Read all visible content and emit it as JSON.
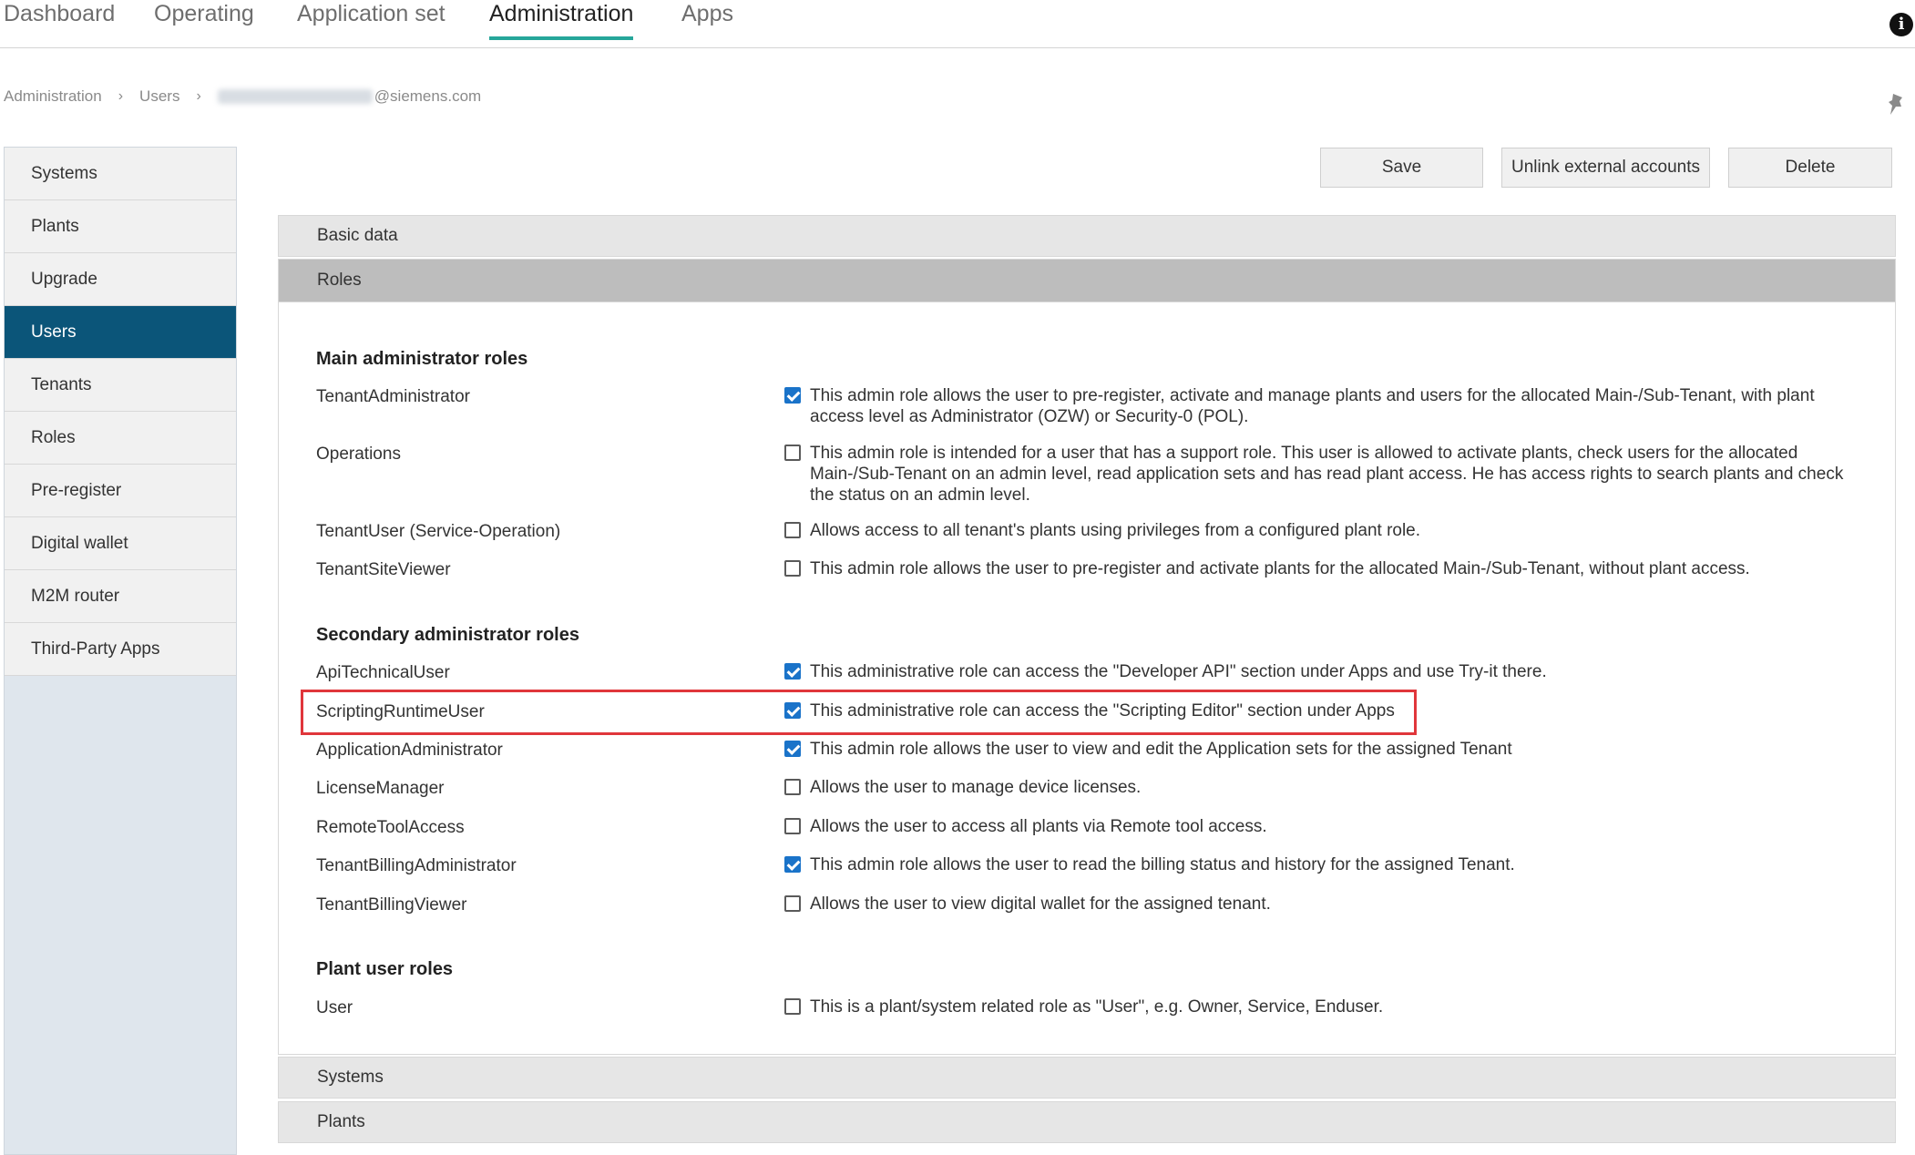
{
  "topnav": {
    "tabs": [
      "Dashboard",
      "Operating",
      "Application set",
      "Administration",
      "Apps"
    ],
    "active_tab": "Administration"
  },
  "breadcrumb": {
    "items": [
      "Administration",
      "Users"
    ],
    "user_suffix": "@siemens.com"
  },
  "sidebar": {
    "items": [
      "Systems",
      "Plants",
      "Upgrade",
      "Users",
      "Tenants",
      "Roles",
      "Pre-register",
      "Digital wallet",
      "M2M router",
      "Third-Party Apps"
    ],
    "active_item": "Users"
  },
  "actions": {
    "save": "Save",
    "unlink": "Unlink external accounts",
    "delete": "Delete"
  },
  "accordion": {
    "basic_data": "Basic data",
    "roles": "Roles",
    "systems": "Systems",
    "plants": "Plants"
  },
  "roles": {
    "main_title": "Main administrator roles",
    "main": [
      {
        "name": "TenantAdministrator",
        "checked": true,
        "desc": "This admin role allows the user to pre-register, activate and manage plants and users for the allocated Main-/Sub-Tenant, with plant access level as Administrator (OZW) or Security-0 (POL)."
      },
      {
        "name": "Operations",
        "checked": false,
        "desc": "This admin role is intended for a user that has a support role. This user is allowed to activate plants, check users for the allocated Main-/Sub-Tenant on an admin level, read application sets and has read plant access. He has access rights to search plants and check the status on an admin level."
      },
      {
        "name": "TenantUser (Service-Operation)",
        "checked": false,
        "desc": "Allows access to all tenant's plants using privileges from a configured plant role."
      },
      {
        "name": "TenantSiteViewer",
        "checked": false,
        "desc": "This admin role allows the user to pre-register and activate plants for the allocated Main-/Sub-Tenant, without plant access."
      }
    ],
    "secondary_title": "Secondary administrator roles",
    "secondary": [
      {
        "name": "ApiTechnicalUser",
        "checked": true,
        "desc": "This administrative role can access the \"Developer API\" section under Apps and use Try-it there."
      },
      {
        "name": "ScriptingRuntimeUser",
        "checked": true,
        "desc": "This administrative role can access the \"Scripting Editor\" section under Apps"
      },
      {
        "name": "ApplicationAdministrator",
        "checked": true,
        "desc": "This admin role allows the user to view and edit the Application sets for the assigned Tenant"
      },
      {
        "name": "LicenseManager",
        "checked": false,
        "desc": "Allows the user to manage device licenses."
      },
      {
        "name": "RemoteToolAccess",
        "checked": false,
        "desc": "Allows the user to access all plants via Remote tool access."
      },
      {
        "name": "TenantBillingAdministrator",
        "checked": true,
        "desc": "This admin role allows the user to read the billing status and history for the assigned Tenant."
      },
      {
        "name": "TenantBillingViewer",
        "checked": false,
        "desc": "Allows the user to view digital wallet for the assigned tenant."
      }
    ],
    "plant_title": "Plant user roles",
    "plant": [
      {
        "name": "User",
        "checked": false,
        "desc": "This is a plant/system related role as \"User\", e.g. Owner, Service, Enduser."
      }
    ]
  },
  "colors": {
    "accent_tab": "#26a69a",
    "sidebar_active": "#0b5579",
    "checkbox_checked": "#1a73c9",
    "highlight": "#e0363b"
  }
}
